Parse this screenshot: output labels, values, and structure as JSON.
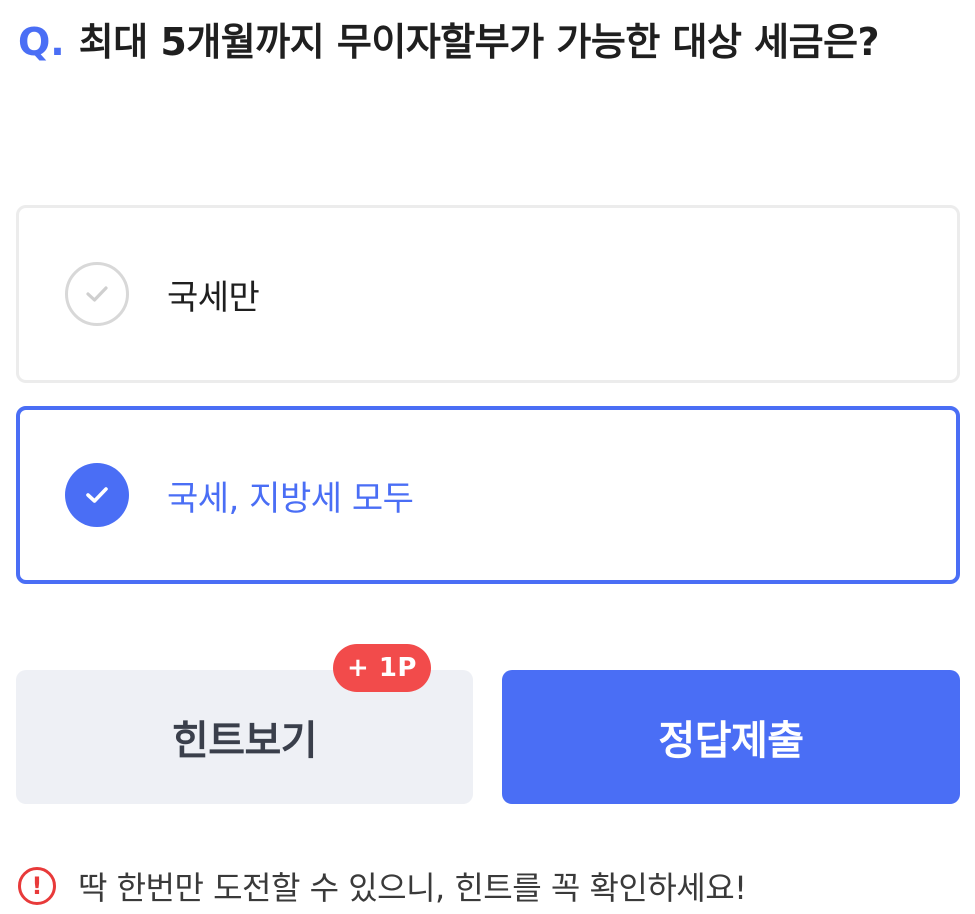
{
  "question": {
    "prefix": "Q.",
    "text": "최대 5개월까지 무이자할부가 가능한 대상 세금은?"
  },
  "options": [
    {
      "label": "국세만",
      "selected": false
    },
    {
      "label": "국세, 지방세 모두",
      "selected": true
    }
  ],
  "buttons": {
    "hint_label": "힌트보기",
    "hint_badge": "+ 1P",
    "submit_label": "정답제출"
  },
  "notice": {
    "icon": "exclamation-circle-icon",
    "text": "딱 한번만 도전할 수 있으니, 힌트를 꼭 확인하세요!"
  },
  "colors": {
    "accent": "#4a6ef5",
    "badge": "#f24b4b",
    "warning": "#e83a3a",
    "hint_bg": "#eef0f5"
  }
}
